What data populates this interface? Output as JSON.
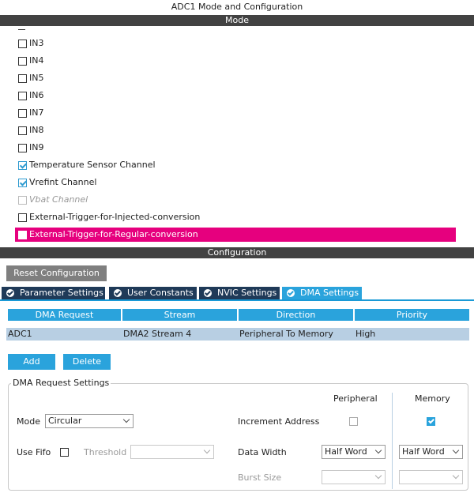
{
  "window_title": "ADC1 Mode and Configuration",
  "mode_header": "Mode",
  "config_header": "Configuration",
  "channels": [
    {
      "label": "IN3",
      "checked": false,
      "disabled": false,
      "selected": false
    },
    {
      "label": "IN4",
      "checked": false,
      "disabled": false,
      "selected": false
    },
    {
      "label": "IN5",
      "checked": false,
      "disabled": false,
      "selected": false
    },
    {
      "label": "IN6",
      "checked": false,
      "disabled": false,
      "selected": false
    },
    {
      "label": "IN7",
      "checked": false,
      "disabled": false,
      "selected": false
    },
    {
      "label": "IN8",
      "checked": false,
      "disabled": false,
      "selected": false
    },
    {
      "label": "IN9",
      "checked": false,
      "disabled": false,
      "selected": false
    },
    {
      "label": "Temperature Sensor Channel",
      "checked": true,
      "disabled": false,
      "selected": false
    },
    {
      "label": "Vrefint Channel",
      "checked": true,
      "disabled": false,
      "selected": false
    },
    {
      "label": "Vbat Channel",
      "checked": false,
      "disabled": true,
      "selected": false
    },
    {
      "label": "External-Trigger-for-Injected-conversion",
      "checked": false,
      "disabled": false,
      "selected": false
    },
    {
      "label": "External-Trigger-for-Regular-conversion",
      "checked": false,
      "disabled": false,
      "selected": true
    }
  ],
  "reset_button": "Reset Configuration",
  "tabs": [
    {
      "label": "Parameter Settings",
      "active": false
    },
    {
      "label": "User Constants",
      "active": false
    },
    {
      "label": "NVIC Settings",
      "active": false
    },
    {
      "label": "DMA Settings",
      "active": true
    }
  ],
  "dma_table": {
    "headers": [
      "DMA Request",
      "Stream",
      "Direction",
      "Priority"
    ],
    "rows": [
      [
        "ADC1",
        "DMA2 Stream 4",
        "Peripheral To Memory",
        "High"
      ]
    ]
  },
  "add_button": "Add",
  "delete_button": "Delete",
  "dma_settings": {
    "group_title": "DMA Request Settings",
    "peripheral_header": "Peripheral",
    "memory_header": "Memory",
    "mode_label": "Mode",
    "mode_value": "Circular",
    "increment_label": "Increment Address",
    "increment_peripheral": false,
    "increment_memory": true,
    "use_fifo_label": "Use Fifo",
    "use_fifo": false,
    "threshold_label": "Threshold",
    "threshold_value": "",
    "data_width_label": "Data Width",
    "data_width_peripheral": "Half Word",
    "data_width_memory": "Half Word",
    "burst_size_label": "Burst Size",
    "burst_peripheral": "",
    "burst_memory": ""
  },
  "colors": {
    "selected_row": "#e6007e",
    "accent": "#2aa3dc",
    "tab_dark": "#1f3a58",
    "header_bar": "#424242"
  }
}
